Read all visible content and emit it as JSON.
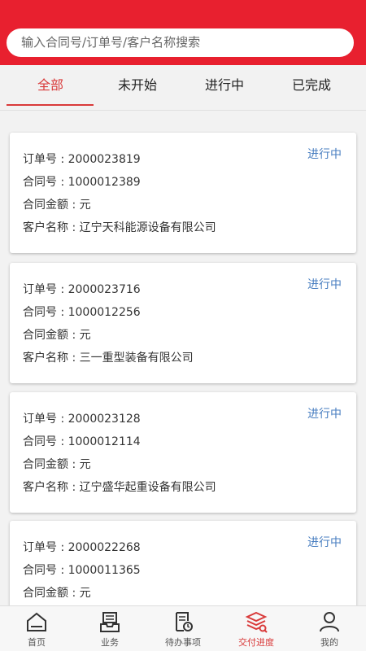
{
  "search": {
    "placeholder": "输入合同号/订单号/客户名称搜索"
  },
  "tabs": [
    {
      "label": "全部",
      "active": true
    },
    {
      "label": "未开始",
      "active": false
    },
    {
      "label": "进行中",
      "active": false
    },
    {
      "label": "已完成",
      "active": false
    }
  ],
  "orders": [
    {
      "order_label": "订单号 : 2000023819",
      "contract_label": "合同号 : 1000012389",
      "amount_label": "合同金额 : 元",
      "customer_label": "客户名称 : 辽宁天科能源设备有限公司",
      "status": "进行中"
    },
    {
      "order_label": "订单号 : 2000023716",
      "contract_label": "合同号 : 1000012256",
      "amount_label": "合同金额 : 元",
      "customer_label": "客户名称 : 三一重型装备有限公司",
      "status": "进行中"
    },
    {
      "order_label": "订单号 : 2000023128",
      "contract_label": "合同号 : 1000012114",
      "amount_label": "合同金额 : 元",
      "customer_label": "客户名称 : 辽宁盛华起重设备有限公司",
      "status": "进行中"
    },
    {
      "order_label": "订单号 : 2000022268",
      "contract_label": "合同号 : 1000011365",
      "amount_label": "合同金额 : 元",
      "customer_label": "",
      "status": "进行中"
    }
  ],
  "tabbar": [
    {
      "label": "首页",
      "icon": "home-icon"
    },
    {
      "label": "业务",
      "icon": "business-icon"
    },
    {
      "label": "待办事项",
      "icon": "todo-icon"
    },
    {
      "label": "交付进度",
      "icon": "delivery-progress-icon",
      "active": true
    },
    {
      "label": "我的",
      "icon": "profile-icon"
    }
  ],
  "colors": {
    "brand_red": "#e8202f",
    "active_red": "#d93a3a",
    "status_blue": "#4a7fc1"
  }
}
